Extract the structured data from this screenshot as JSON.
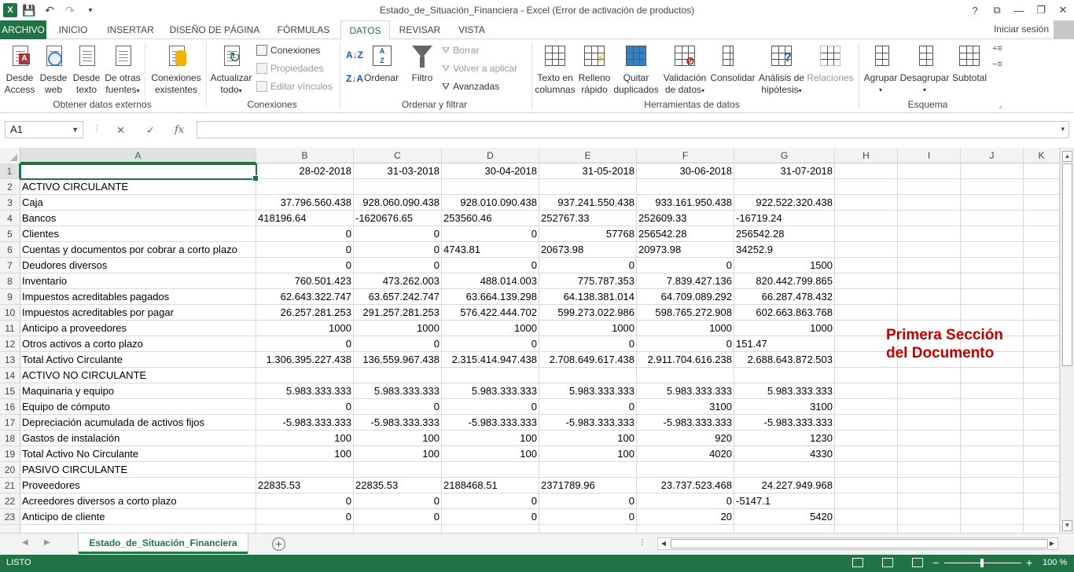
{
  "app": {
    "title": "Estado_de_Situación_Financiera - Excel (Error de activación de productos)",
    "signin": "Iniciar sesión",
    "help": "?"
  },
  "tabs": [
    "ARCHIVO",
    "INICIO",
    "INSERTAR",
    "DISEÑO DE PÁGINA",
    "FÓRMULAS",
    "DATOS",
    "REVISAR",
    "VISTA"
  ],
  "ribbon": {
    "obtener": {
      "access": [
        "Desde",
        "Access"
      ],
      "web": [
        "Desde",
        "web"
      ],
      "texto": [
        "Desde",
        "texto"
      ],
      "otras": [
        "De otras",
        "fuentes"
      ],
      "existentes": [
        "Conexiones",
        "existentes"
      ],
      "label": "Obtener datos externos"
    },
    "conexiones": {
      "actualizar": [
        "Actualizar",
        "todo"
      ],
      "conexiones": "Conexiones",
      "propiedades": "Propiedades",
      "editar": "Editar vínculos",
      "label": "Conexiones"
    },
    "ordenar": {
      "ordenar": "Ordenar",
      "filtro": "Filtro",
      "borrar": "Borrar",
      "volver": "Volver a aplicar",
      "avanzadas": "Avanzadas",
      "label": "Ordenar y filtrar"
    },
    "herramientas": {
      "texto_col": [
        "Texto en",
        "columnas"
      ],
      "relleno": [
        "Relleno",
        "rápido"
      ],
      "quitar": [
        "Quitar",
        "duplicados"
      ],
      "validacion": [
        "Validación",
        "de datos"
      ],
      "consolidar": "Consolidar",
      "analisis": [
        "Análisis de",
        "hipótesis"
      ],
      "relaciones": "Relaciones",
      "label": "Herramientas de datos"
    },
    "esquema": {
      "agrupar": "Agrupar",
      "desagrupar": "Desagrupar",
      "subtotal": "Subtotal",
      "label": "Esquema"
    }
  },
  "formula": {
    "namebox": "A1",
    "fx": "fx",
    "content": ""
  },
  "columns": [
    "A",
    "B",
    "C",
    "D",
    "E",
    "F",
    "G",
    "H",
    "I",
    "J",
    "K"
  ],
  "rows": [
    {
      "n": "1",
      "cells": [
        "",
        "28-02-2018",
        "31-03-2018",
        "30-04-2018",
        "31-05-2018",
        "30-06-2018",
        "31-07-2018"
      ],
      "align": [
        "l",
        "r",
        "r",
        "r",
        "r",
        "r",
        "r"
      ]
    },
    {
      "n": "2",
      "cells": [
        "ACTIVO CIRCULANTE",
        "",
        "",
        "",
        "",
        "",
        ""
      ],
      "align": [
        "l",
        "r",
        "r",
        "r",
        "r",
        "r",
        "r"
      ]
    },
    {
      "n": "3",
      "cells": [
        "Caja",
        "37.796.560.438",
        "928.060.090.438",
        "928.010.090.438",
        "937.241.550.438",
        "933.161.950.438",
        "922.522.320.438"
      ],
      "align": [
        "l",
        "r",
        "r",
        "r",
        "r",
        "r",
        "r"
      ]
    },
    {
      "n": "4",
      "cells": [
        "Bancos",
        "418196.64",
        "-1620676.65",
        "253560.46",
        "252767.33",
        "252609.33",
        "-16719.24"
      ],
      "align": [
        "l",
        "l",
        "l",
        "l",
        "l",
        "l",
        "l"
      ]
    },
    {
      "n": "5",
      "cells": [
        "Clientes",
        "0",
        "0",
        "0",
        "57768",
        "256542.28",
        "256542.28"
      ],
      "align": [
        "l",
        "r",
        "r",
        "r",
        "r",
        "l",
        "l"
      ]
    },
    {
      "n": "6",
      "cells": [
        "Cuentas y documentos por cobrar a corto plazo",
        "0",
        "0",
        "4743.81",
        "20673.98",
        "20973.98",
        "34252.9"
      ],
      "align": [
        "l",
        "r",
        "r",
        "l",
        "l",
        "l",
        "l"
      ]
    },
    {
      "n": "7",
      "cells": [
        "Deudores diversos",
        "0",
        "0",
        "0",
        "0",
        "0",
        "1500"
      ],
      "align": [
        "l",
        "r",
        "r",
        "r",
        "r",
        "r",
        "r"
      ]
    },
    {
      "n": "8",
      "cells": [
        "Inventario",
        "760.501.423",
        "473.262.003",
        "488.014.003",
        "775.787.353",
        "7.839.427.136",
        "820.442.799.865"
      ],
      "align": [
        "l",
        "r",
        "r",
        "r",
        "r",
        "r",
        "r"
      ]
    },
    {
      "n": "9",
      "cells": [
        "Impuestos acreditables pagados",
        "62.643.322.747",
        "63.657.242.747",
        "63.664.139.298",
        "64.138.381.014",
        "64.709.089.292",
        "66.287.478.432"
      ],
      "align": [
        "l",
        "r",
        "r",
        "r",
        "r",
        "r",
        "r"
      ]
    },
    {
      "n": "10",
      "cells": [
        "Impuestos acreditables por pagar",
        "26.257.281.253",
        "291.257.281.253",
        "576.422.444.702",
        "599.273.022.986",
        "598.765.272.908",
        "602.663.863.768"
      ],
      "align": [
        "l",
        "r",
        "r",
        "r",
        "r",
        "r",
        "r"
      ]
    },
    {
      "n": "11",
      "cells": [
        "Anticipo a proveedores",
        "1000",
        "1000",
        "1000",
        "1000",
        "1000",
        "1000"
      ],
      "align": [
        "l",
        "r",
        "r",
        "r",
        "r",
        "r",
        "r"
      ]
    },
    {
      "n": "12",
      "cells": [
        "Otros activos a corto plazo",
        "0",
        "0",
        "0",
        "0",
        "0",
        "151.47"
      ],
      "align": [
        "l",
        "r",
        "r",
        "r",
        "r",
        "r",
        "l"
      ]
    },
    {
      "n": "13",
      "cells": [
        "Total Activo Circulante",
        "1.306.395.227.438",
        "136.559.967.438",
        "2.315.414.947.438",
        "2.708.649.617.438",
        "2.911.704.616.238",
        "2.688.643.872.503"
      ],
      "align": [
        "l",
        "r",
        "r",
        "r",
        "r",
        "r",
        "r"
      ]
    },
    {
      "n": "14",
      "cells": [
        "ACTIVO NO CIRCULANTE",
        "",
        "",
        "",
        "",
        "",
        ""
      ],
      "align": [
        "l",
        "r",
        "r",
        "r",
        "r",
        "r",
        "r"
      ]
    },
    {
      "n": "15",
      "cells": [
        "Maquinaria y equipo",
        "5.983.333.333",
        "5.983.333.333",
        "5.983.333.333",
        "5.983.333.333",
        "5.983.333.333",
        "5.983.333.333"
      ],
      "align": [
        "l",
        "r",
        "r",
        "r",
        "r",
        "r",
        "r"
      ]
    },
    {
      "n": "16",
      "cells": [
        "Equipo de cómputo",
        "0",
        "0",
        "0",
        "0",
        "3100",
        "3100"
      ],
      "align": [
        "l",
        "r",
        "r",
        "r",
        "r",
        "r",
        "r"
      ]
    },
    {
      "n": "17",
      "cells": [
        "Depreciación acumulada de activos fijos",
        "-5.983.333.333",
        "-5.983.333.333",
        "-5.983.333.333",
        "-5.983.333.333",
        "-5.983.333.333",
        "-5.983.333.333"
      ],
      "align": [
        "l",
        "r",
        "r",
        "r",
        "r",
        "r",
        "r"
      ]
    },
    {
      "n": "18",
      "cells": [
        "Gastos de instalación",
        "100",
        "100",
        "100",
        "100",
        "920",
        "1230"
      ],
      "align": [
        "l",
        "r",
        "r",
        "r",
        "r",
        "r",
        "r"
      ]
    },
    {
      "n": "19",
      "cells": [
        "Total Activo No Circulante",
        "100",
        "100",
        "100",
        "100",
        "4020",
        "4330"
      ],
      "align": [
        "l",
        "r",
        "r",
        "r",
        "r",
        "r",
        "r"
      ]
    },
    {
      "n": "20",
      "cells": [
        "PASIVO CIRCULANTE",
        "",
        "",
        "",
        "",
        "",
        ""
      ],
      "align": [
        "l",
        "r",
        "r",
        "r",
        "r",
        "r",
        "r"
      ]
    },
    {
      "n": "21",
      "cells": [
        "Proveedores",
        "22835.53",
        "22835.53",
        "2188468.51",
        "2371789.96",
        "23.737.523.468",
        "24.227.949.968"
      ],
      "align": [
        "l",
        "l",
        "l",
        "l",
        "l",
        "r",
        "r"
      ]
    },
    {
      "n": "22",
      "cells": [
        "Acreedores diversos a corto plazo",
        "0",
        "0",
        "0",
        "0",
        "0",
        "-5147.1"
      ],
      "align": [
        "l",
        "r",
        "r",
        "r",
        "r",
        "r",
        "l"
      ]
    },
    {
      "n": "23",
      "cells": [
        "Anticipo de cliente",
        "0",
        "0",
        "0",
        "0",
        "20",
        "5420"
      ],
      "align": [
        "l",
        "r",
        "r",
        "r",
        "r",
        "r",
        "r"
      ]
    }
  ],
  "annotation": [
    "Primera Sección",
    "del Documento"
  ],
  "sheet": {
    "name": "Estado_de_Situación_Financiera",
    "add": "+"
  },
  "status": {
    "text": "LISTO",
    "zoom": "100 %"
  }
}
